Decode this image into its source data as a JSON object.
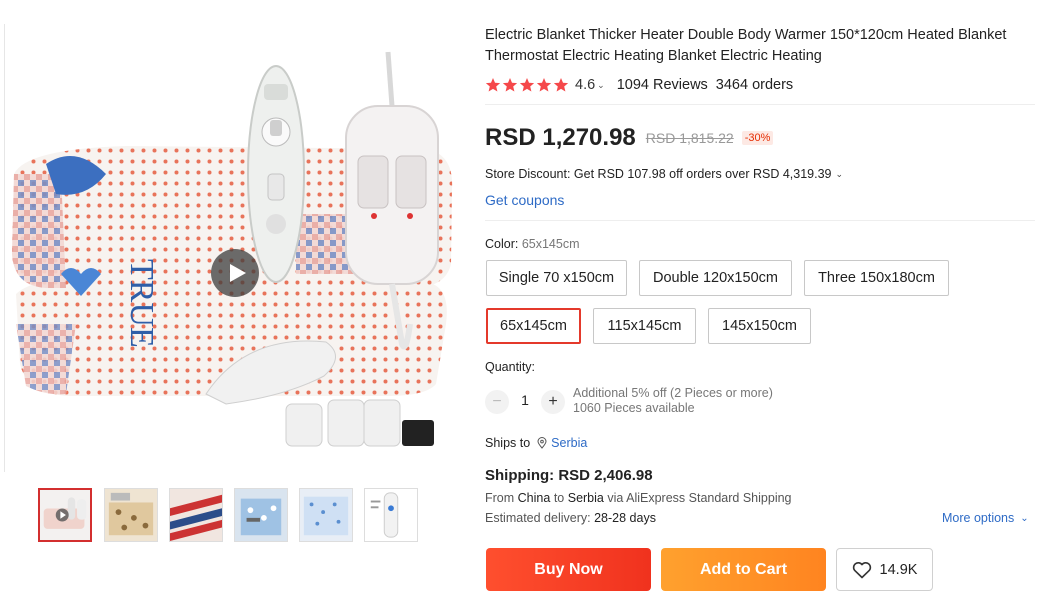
{
  "product": {
    "title": "Electric Blanket Thicker Heater Double Body Warmer 150*120cm Heated Blanket Thermostat Electric Heating Blanket Electric Heating",
    "rating": "4.6",
    "reviews": "1094 Reviews",
    "orders": "3464 orders",
    "rating_chevron": "⌄"
  },
  "price": {
    "current": "RSD 1,270.98",
    "original": "RSD 1,815.22",
    "discount": "-30%"
  },
  "store_discount": {
    "text": "Store Discount: Get RSD 107.98 off orders over RSD 4,319.39",
    "chevron": "⌄"
  },
  "coupons": {
    "label": "Get coupons"
  },
  "color": {
    "label": "Color:",
    "selected": "65x145cm",
    "options": [
      "Single 70 x150cm",
      "Double 120x150cm",
      "Three 150x180cm",
      "65x145cm",
      "115x145cm",
      "145x150cm"
    ]
  },
  "quantity": {
    "label": "Quantity:",
    "minus": "−",
    "plus": "+",
    "value": "1",
    "note_line1": "Additional 5% off (2 Pieces or more)",
    "note_line2": "1060 Pieces available"
  },
  "shipping": {
    "ships_to_label": "Ships to",
    "country": "Serbia",
    "cost": "Shipping: RSD 2,406.98",
    "from_prefix": "From",
    "from_country": "China",
    "to_word": "to",
    "to_country": "Serbia",
    "via": "via AliExpress Standard Shipping",
    "delivery_label": "Estimated delivery:",
    "delivery_value": "28-28 days",
    "more_options": "More options",
    "more_chevron": "⌄"
  },
  "actions": {
    "buy_now": "Buy Now",
    "add_to_cart": "Add to Cart",
    "wishlist_count": "14.9K"
  },
  "colors": {
    "accent_red": "#e4392b",
    "star": "#f5484a",
    "link_blue": "#2e6bc6",
    "buy_now": "#f5361f",
    "add_to_cart": "#ff9424"
  },
  "icons": {
    "play": "play-icon",
    "star": "star-icon",
    "pin": "location-pin-icon",
    "heart": "heart-icon"
  }
}
